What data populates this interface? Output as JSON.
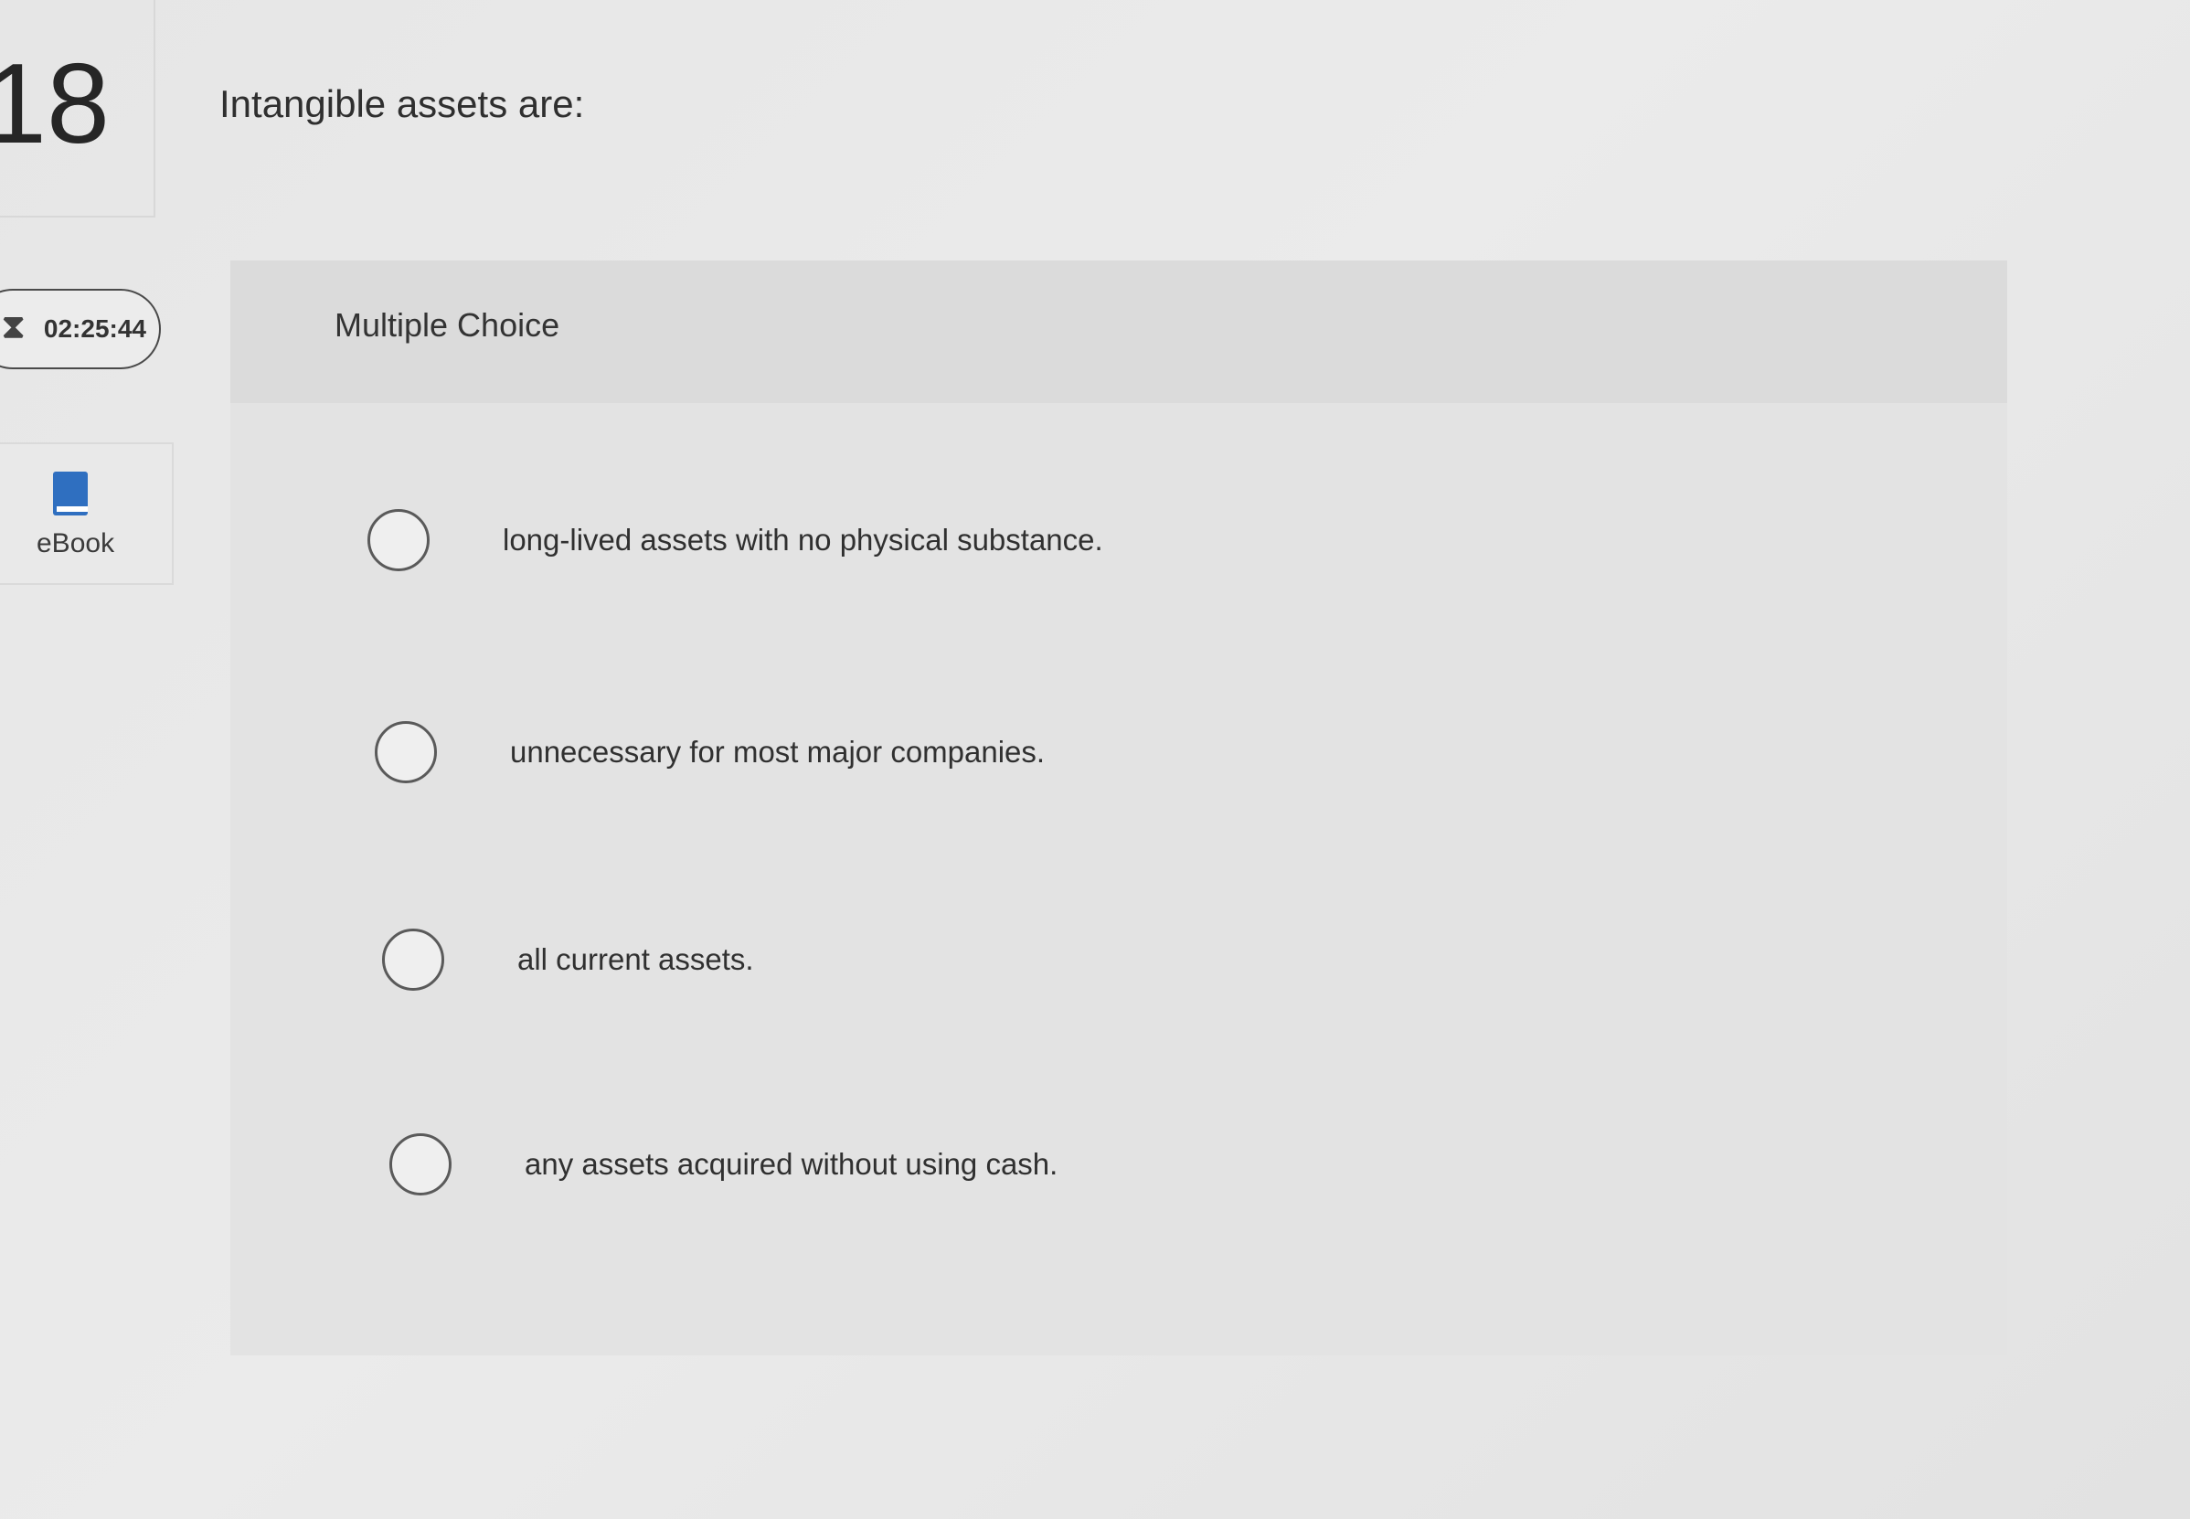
{
  "question": {
    "number": "18",
    "prompt": "Intangible assets are:"
  },
  "timer": {
    "value": "02:25:44",
    "icon": "hourglass-icon"
  },
  "ebook": {
    "label": "eBook",
    "icon": "book-icon",
    "icon_color": "#2f6fc0"
  },
  "card": {
    "title": "Multiple Choice",
    "options": [
      {
        "label": "long-lived assets with no physical substance."
      },
      {
        "label": "unnecessary for most major companies."
      },
      {
        "label": "all current assets."
      },
      {
        "label": "any assets acquired without using cash."
      }
    ]
  }
}
